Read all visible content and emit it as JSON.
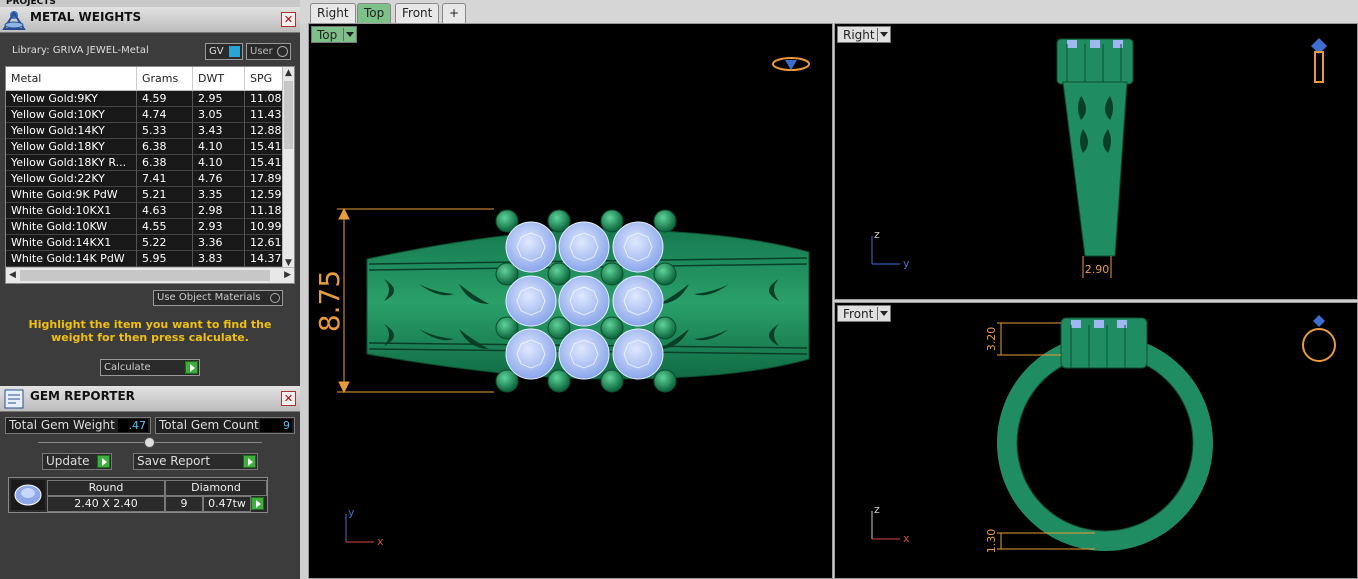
{
  "projects": {
    "title": "PROJECTS"
  },
  "metal_weights": {
    "title": "METAL WEIGHTS",
    "library": "Library: GRIVA JEWEL-Metal",
    "gv_label": "GV",
    "user_label": "User",
    "columns": [
      "Metal",
      "Grams",
      "DWT",
      "SPG"
    ],
    "rows": [
      [
        "Yellow Gold:9KY",
        "4.59",
        "2.95",
        "11.08"
      ],
      [
        "Yellow Gold:10KY",
        "4.74",
        "3.05",
        "11.43"
      ],
      [
        "Yellow Gold:14KY",
        "5.33",
        "3.43",
        "12.88"
      ],
      [
        "Yellow Gold:18KY",
        "6.38",
        "4.10",
        "15.41"
      ],
      [
        "Yellow Gold:18KY R...",
        "6.38",
        "4.10",
        "15.41"
      ],
      [
        "Yellow Gold:22KY",
        "7.41",
        "4.76",
        "17.89"
      ],
      [
        "White Gold:9K PdW",
        "5.21",
        "3.35",
        "12.59"
      ],
      [
        "White Gold:10KX1",
        "4.63",
        "2.98",
        "11.18"
      ],
      [
        "White Gold:10KW",
        "4.55",
        "2.93",
        "10.99"
      ],
      [
        "White Gold:14KX1",
        "5.22",
        "3.36",
        "12.61"
      ],
      [
        "White Gold:14K PdW",
        "5.95",
        "3.83",
        "14.37"
      ]
    ],
    "use_object_materials": "Use Object Materials",
    "hint": "Highlight the item you want to find the weight for then press calculate.",
    "calculate_label": "Calculate"
  },
  "gem_reporter": {
    "title": "GEM REPORTER",
    "total_weight_label": "Total Gem Weight",
    "total_weight_value": ".47",
    "total_count_label": "Total Gem Count",
    "total_count_value": "9",
    "update_label": "Update",
    "save_report_label": "Save Report",
    "gem": {
      "shape": "Round",
      "size": "2.40 X 2.40",
      "type": "Diamond",
      "count": "9",
      "weight": "0.47tw"
    }
  },
  "tabs": [
    "Right",
    "Top",
    "Front",
    "+"
  ],
  "active_tab": "Top",
  "viewports": {
    "top": {
      "label": "Top",
      "dimension": "8.75",
      "axis_y": "y",
      "axis_x": "x"
    },
    "right": {
      "label": "Right",
      "dimension": "2.90",
      "axis_z": "z",
      "axis_y": "y"
    },
    "front": {
      "label": "Front",
      "dim_top": "3.20",
      "dim_bottom": "1.30",
      "axis_z": "z",
      "axis_x": "x"
    }
  },
  "colors": {
    "ring": "#1f8c61",
    "gem": "#9fb8f2",
    "dimension": "#e89b3a",
    "hint": "#f0c010",
    "active_tab": "#7ec089"
  }
}
